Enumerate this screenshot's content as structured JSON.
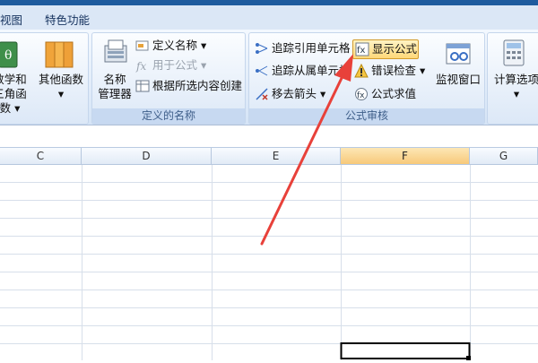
{
  "tabs": [
    "视图",
    "特色功能"
  ],
  "ribbon": {
    "functions_group": {
      "math": {
        "label_line1": "数学和",
        "label_line2": "三角函数 ▾"
      },
      "other": {
        "label_line1": "其他函数",
        "arrow": "▾"
      }
    },
    "names_group": {
      "title": "定义的名称",
      "name_manager": {
        "label_line1": "名称",
        "label_line2": "管理器"
      },
      "define_name": "定义名称 ▾",
      "use_in_formula": "用于公式 ▾",
      "create_from_selection": "根据所选内容创建"
    },
    "audit_group": {
      "title": "公式审核",
      "trace_precedents": "追踪引用单元格",
      "trace_dependents": "追踪从属单元格",
      "remove_arrows": "移去箭头 ▾",
      "show_formulas": "显示公式",
      "error_checking": "错误检查 ▾",
      "evaluate_formula": "公式求值",
      "watch_window": "监视窗口"
    },
    "calc_group": {
      "calc_options": "计算选项",
      "arrow": "▾"
    }
  },
  "columns": [
    "C",
    "D",
    "E",
    "F",
    "G"
  ],
  "selected_column": "F",
  "colors": {
    "accent_arrow": "#e8413a",
    "selected_header": "#f7c97a",
    "highlight": "#ffd879"
  }
}
